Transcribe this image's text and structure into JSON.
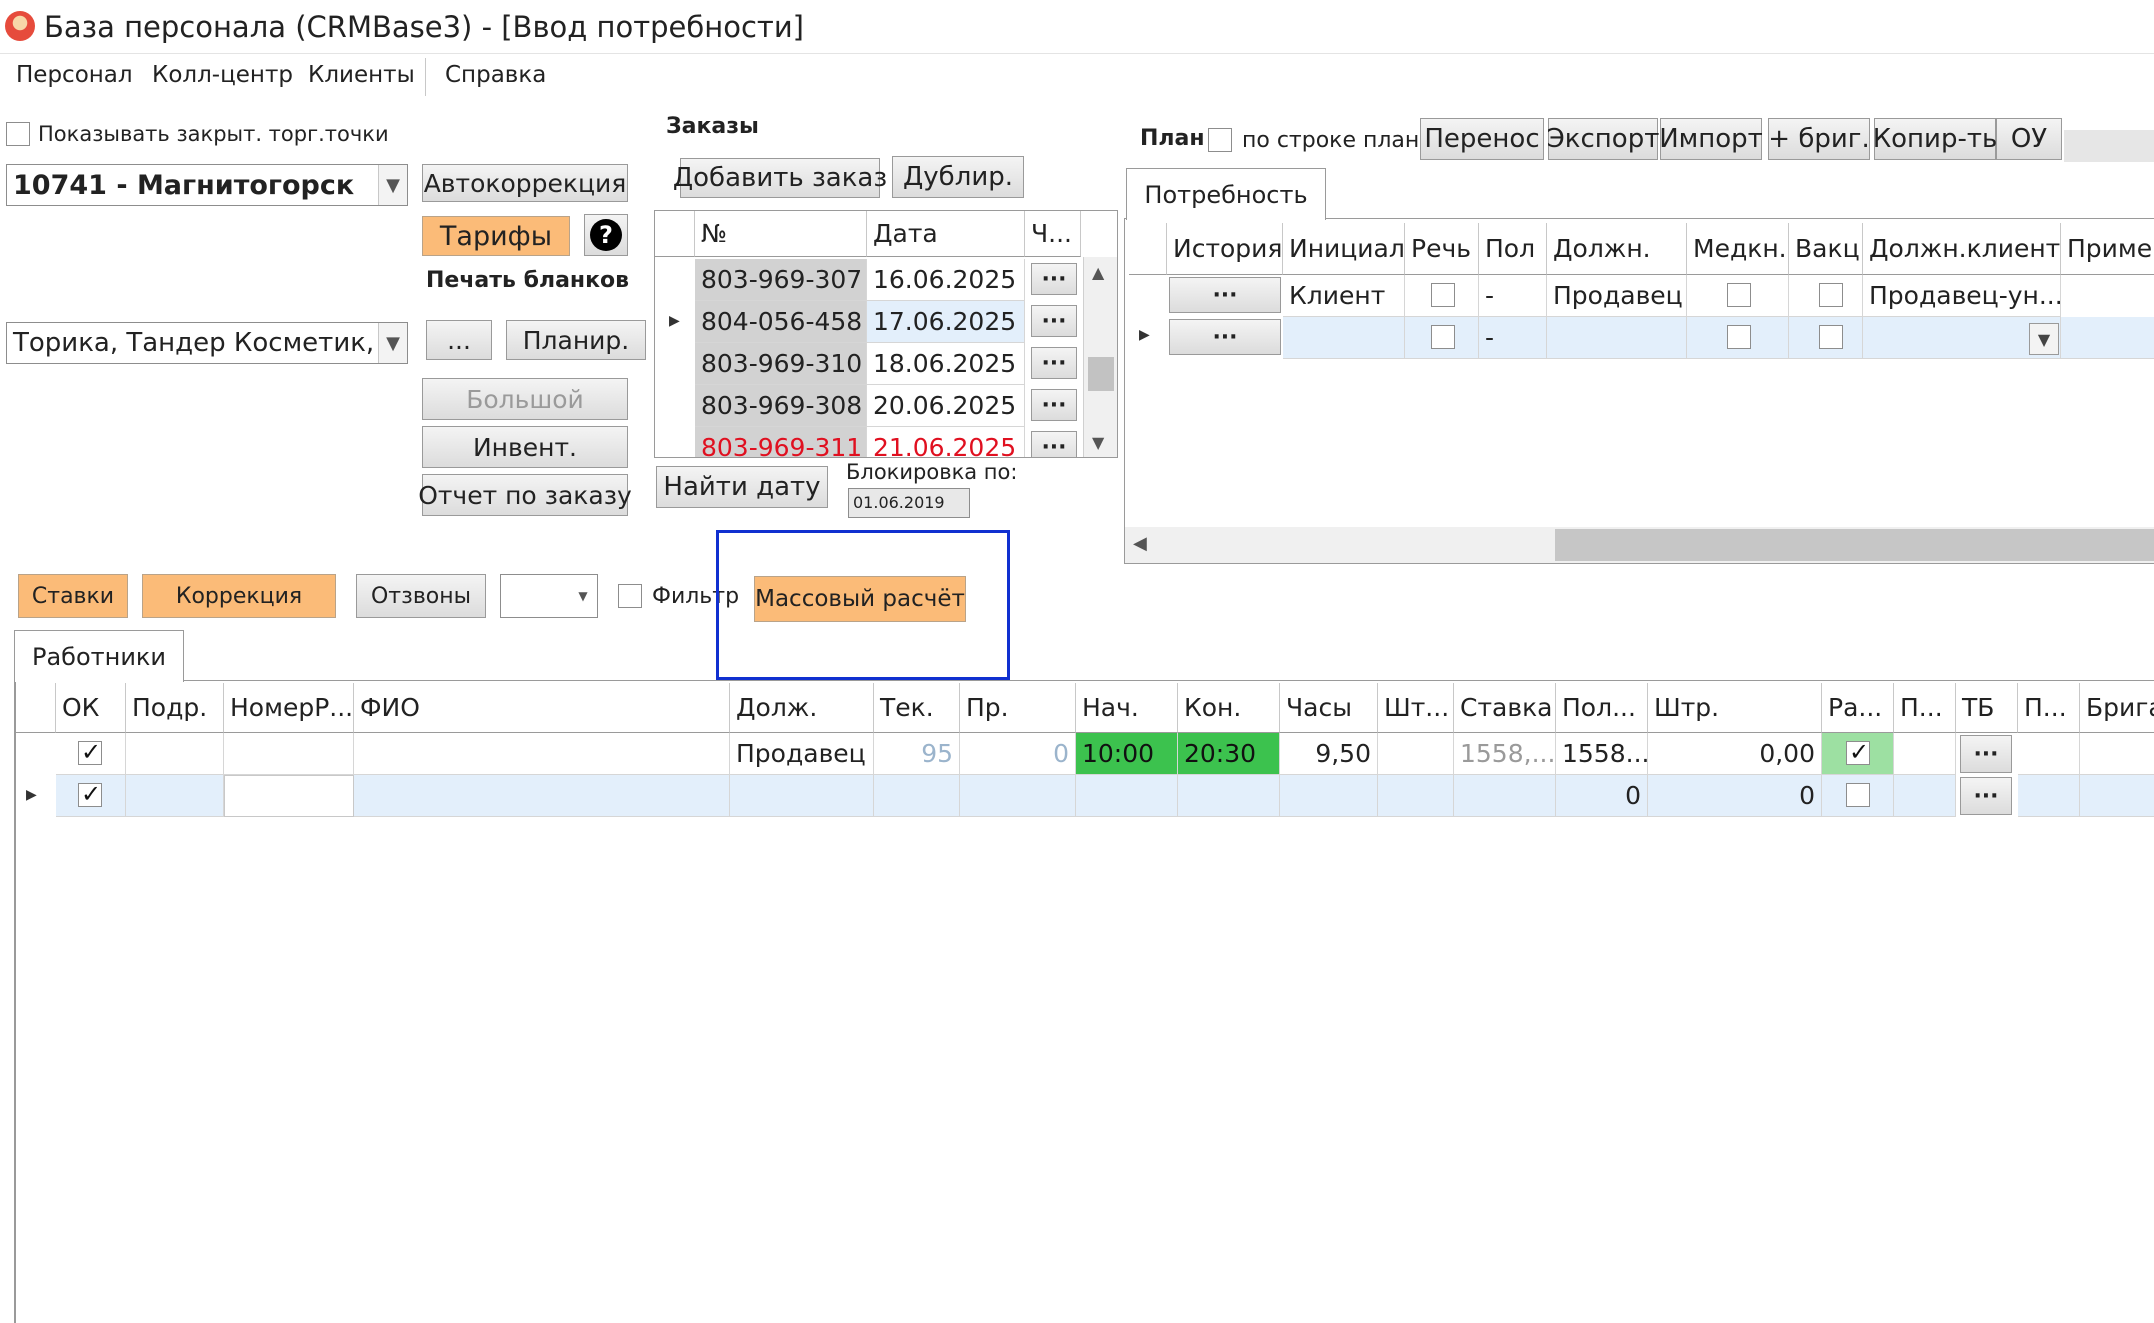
{
  "window": {
    "title": "База персонала (CRMBase3) - [Ввод потребности]"
  },
  "menu": [
    "Персонал",
    "Колл-центр",
    "Клиенты",
    "Справка"
  ],
  "left": {
    "show_closed_label": "Показывать закрыт. торг.точки",
    "store_value": "10741 - Магнитогорск",
    "clients_value": "Торика, Тандер Косметик, Тор",
    "autocorrect": "Автокоррекция",
    "tariffs": "Тарифы",
    "help": "?",
    "print_forms": "Печать бланков",
    "ellipsis": "...",
    "plan": "Планир.",
    "big": "Большой",
    "invent": "Инвент.",
    "order_report": "Отчет по заказу"
  },
  "orders": {
    "title": "Заказы",
    "add": "Добавить заказ",
    "dup": "Дублир.",
    "headers": [
      "№",
      "Дата",
      "Ч..."
    ],
    "rows": [
      {
        "num": "803-969-307",
        "date": "16.06.2025",
        "more": "···"
      },
      {
        "num": "804-056-458",
        "date": "17.06.2025",
        "more": "···"
      },
      {
        "num": "803-969-310",
        "date": "18.06.2025",
        "more": "···"
      },
      {
        "num": "803-969-308",
        "date": "20.06.2025",
        "more": "···"
      },
      {
        "num": "803-969-311",
        "date": "21.06.2025",
        "more": "···"
      }
    ],
    "find_date": "Найти дату",
    "block_label": "Блокировка по:",
    "block_value": "01.06.2019"
  },
  "plan": {
    "title": "План",
    "by_row": "по строке план",
    "buttons": [
      "Перенос",
      "Экспорт",
      "Импорт",
      "+ бриг.",
      "Копир-ть",
      "ОУ"
    ]
  },
  "need": {
    "tab": "Потребность",
    "headers": [
      "История",
      "Инициал.",
      "Речь",
      "Пол",
      "Должн.",
      "Медкн.",
      "Вакц.",
      "Должн.клиента",
      "Приме"
    ],
    "row1": {
      "hist": "···",
      "init": "Клиент",
      "sex": "-",
      "pos": "Продавец",
      "client_pos": "Продавец-ун..."
    },
    "row2": {
      "hist": "···",
      "sex": "-"
    }
  },
  "toolbar": {
    "rates": "Ставки",
    "correction": "Коррекция",
    "callbacks": "Отзвоны",
    "filter": "Фильтр",
    "mass_calc": "Массовый расчёт"
  },
  "workers": {
    "tab": "Работники",
    "headers": [
      "ОК",
      "Подр.",
      "НомерР...",
      "ФИО",
      "Долж.",
      "Тек.",
      "Пр.",
      "Нач.",
      "Кон.",
      "Часы",
      "Шт...",
      "Ставка",
      "Пол...",
      "Штр.",
      "Ра...",
      "П...",
      "ТБ",
      "П...",
      "Бригад"
    ],
    "row1": {
      "pos": "Продавец",
      "cur": "95",
      "pr": "0",
      "start": "10:00",
      "end": "20:30",
      "hours": "9,50",
      "rate": "1558,...",
      "pol": "1558...",
      "fine": "0,00",
      "more": "···"
    },
    "row2": {
      "pol": "0",
      "fine": "0",
      "more": "···"
    }
  },
  "colors": {
    "accent_orange": "#fbbb78",
    "highlight_blue": "#1030d0",
    "green": "#3cc24e",
    "row_select": "#e3effb",
    "order_red": "#e01020"
  }
}
